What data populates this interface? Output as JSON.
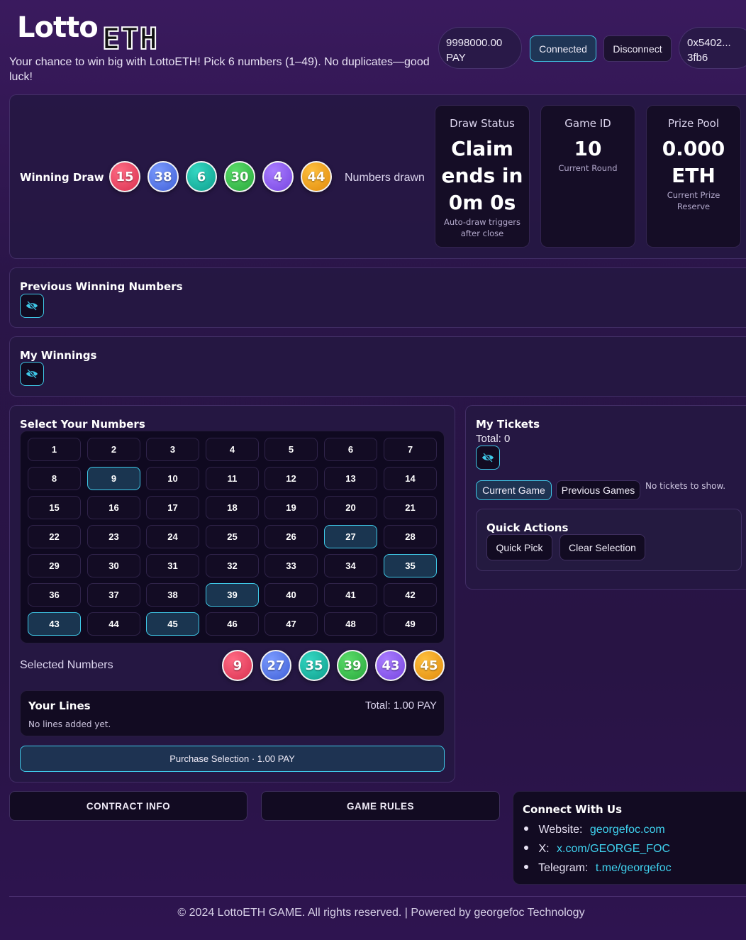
{
  "header": {
    "logo_part1": "Lotto",
    "logo_part2": "ETH",
    "tagline": "Your chance to win big with LottoETH! Pick 6 numbers (1–49). No duplicates—good luck!",
    "balance": "9998000.00 PAY",
    "connected_label": "Connected",
    "disconnect_label": "Disconnect",
    "address": "0x5402... 3fb6"
  },
  "winning_draw": {
    "label": "Winning Draw",
    "balls": [
      {
        "value": "15",
        "color": "#d8304f"
      },
      {
        "value": "38",
        "color": "#3f5fd6"
      },
      {
        "value": "6",
        "color": "#0f9f8d"
      },
      {
        "value": "30",
        "color": "#28a83c"
      },
      {
        "value": "4",
        "color": "#7645e0"
      },
      {
        "value": "44",
        "color": "#e08a0a"
      }
    ],
    "status_text": "Numbers drawn"
  },
  "stats": {
    "draw_status": {
      "label": "Draw Status",
      "line1": "Claim",
      "line2": "ends in",
      "line3": "0m 0s",
      "sub1": "Auto-draw triggers",
      "sub2": "after close"
    },
    "game_id": {
      "label": "Game ID",
      "value": "10",
      "sub": "Current Round"
    },
    "prize_pool": {
      "label": "Prize Pool",
      "value1": "0.000",
      "value2": "ETH",
      "sub1": "Current Prize",
      "sub2": "Reserve"
    }
  },
  "previous_winning": {
    "title": "Previous Winning Numbers"
  },
  "my_winnings": {
    "title": "My Winnings"
  },
  "select_numbers": {
    "title": "Select Your Numbers",
    "numbers": [
      "1",
      "2",
      "3",
      "4",
      "5",
      "6",
      "7",
      "8",
      "9",
      "10",
      "11",
      "12",
      "13",
      "14",
      "15",
      "16",
      "17",
      "18",
      "19",
      "20",
      "21",
      "22",
      "23",
      "24",
      "25",
      "26",
      "27",
      "28",
      "29",
      "30",
      "31",
      "32",
      "33",
      "34",
      "35",
      "36",
      "37",
      "38",
      "39",
      "40",
      "41",
      "42",
      "43",
      "44",
      "45",
      "46",
      "47",
      "48",
      "49"
    ],
    "selected": [
      9,
      27,
      35,
      39,
      43,
      45
    ],
    "selected_label": "Selected Numbers",
    "selected_balls": [
      "9",
      "27",
      "35",
      "39",
      "43",
      "45"
    ]
  },
  "your_lines": {
    "title": "Your Lines",
    "total": "Total: 1.00 PAY",
    "empty": "No lines added yet."
  },
  "purchase": {
    "label": "Purchase Selection · 1.00 PAY"
  },
  "my_tickets": {
    "title": "My Tickets",
    "total": "Total: 0",
    "tab_current": "Current Game",
    "tab_previous": "Previous Games",
    "empty": "No tickets to show."
  },
  "quick_actions": {
    "title": "Quick Actions",
    "quick_pick": "Quick Pick",
    "clear": "Clear Selection"
  },
  "footer_buttons": {
    "contract_info": "CONTRACT INFO",
    "game_rules": "GAME RULES"
  },
  "connect": {
    "title": "Connect With Us",
    "items": [
      {
        "label": "Website:",
        "link": "georgefoc.com"
      },
      {
        "label": "X:",
        "link": "x.com/GEORGE_FOC"
      },
      {
        "label": "Telegram:",
        "link": "t.me/georgefoc"
      }
    ]
  },
  "copyright": "© 2024 LottoETH GAME. All rights reserved. | Powered by georgefoc Technology",
  "colors": {
    "accent": "#3fc9e8",
    "bg": "#2a1548",
    "card": "#150d26"
  }
}
